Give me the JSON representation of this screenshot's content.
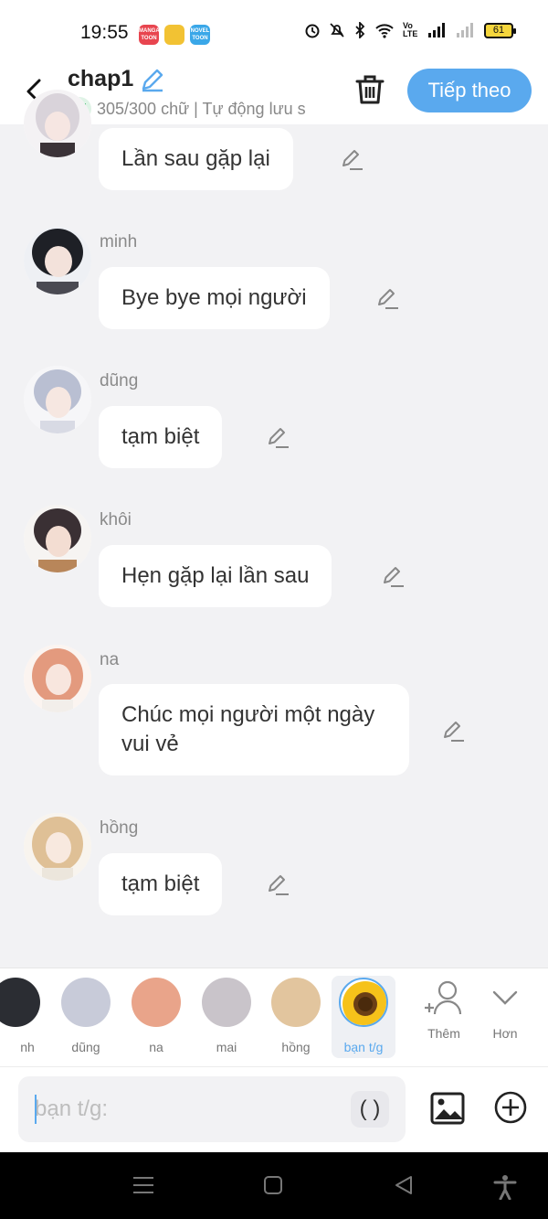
{
  "status": {
    "time": "19:55",
    "badges": [
      {
        "label": "MANGA TOON",
        "color": "#e8454f"
      },
      {
        "label": "",
        "color": "#f2c233"
      },
      {
        "label": "NOVEL TOON",
        "color": "#3aa7e8"
      }
    ],
    "battery": "61",
    "volte": "Vo LTE"
  },
  "header": {
    "title": "chap1",
    "word_count": "305/300 chữ | Tự động lưu s",
    "next_label": "Tiếp theo"
  },
  "messages": [
    {
      "name": "",
      "text": "Lần sau gặp lại"
    },
    {
      "name": "minh",
      "text": "Bye bye mọi người"
    },
    {
      "name": "dũng",
      "text": "tạm biệt"
    },
    {
      "name": "khôi",
      "text": "Hẹn gặp lại lần sau"
    },
    {
      "name": "na",
      "text": "Chúc mọi người một ngày vui vẻ"
    },
    {
      "name": "hồng",
      "text": "tạm biệt"
    }
  ],
  "characters": [
    {
      "label": "nh",
      "color": "#2b2d33"
    },
    {
      "label": "dũng",
      "color": "#c8cbd9"
    },
    {
      "label": "na",
      "color": "#e9a48a"
    },
    {
      "label": "mai",
      "color": "#c9c4ca"
    },
    {
      "label": "hồng",
      "color": "#e2c59e"
    },
    {
      "label": "bạn t/g",
      "color": "#f3b81d"
    }
  ],
  "tools": {
    "add_label": "Thêm",
    "more_label": "Hơn"
  },
  "input": {
    "placeholder": "bạn t/g:",
    "paren_label": "( )"
  },
  "colors": {
    "accent": "#5aa9ee",
    "background": "#f2f2f4"
  }
}
